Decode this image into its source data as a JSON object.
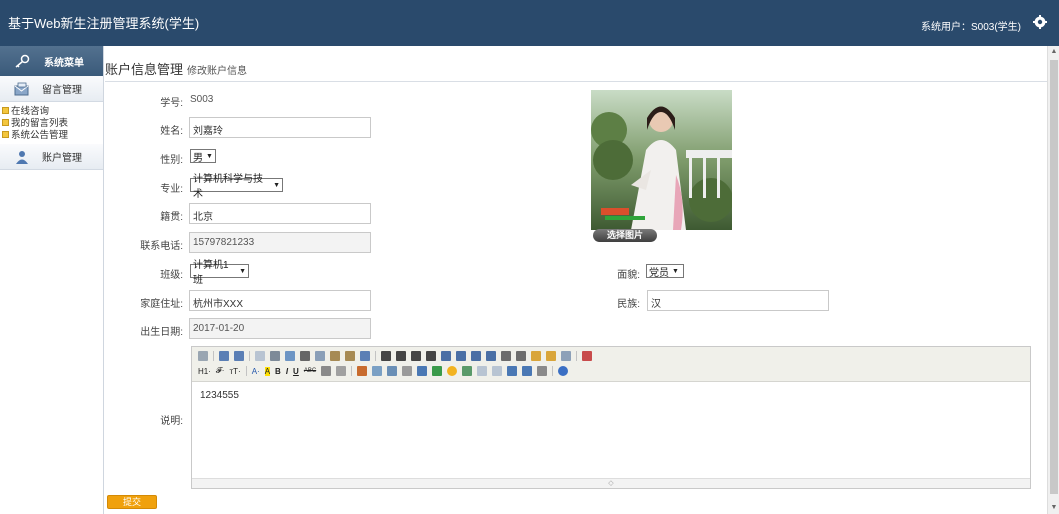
{
  "header": {
    "app_title": "基于Web新生注册管理系统(学生)",
    "user_label": "系统用户：",
    "user_value": "S003(学生)"
  },
  "sidebar": {
    "menu_title": "系统菜单",
    "sections": [
      {
        "label": "留言管理",
        "items": [
          "在线咨询",
          "我的留言列表",
          "系统公告管理"
        ]
      },
      {
        "label": "账户管理",
        "items": []
      }
    ]
  },
  "main": {
    "title": "账户信息管理",
    "subtitle": "修改账户信息"
  },
  "form": {
    "student_id": {
      "label": "学号:",
      "value": "S003"
    },
    "name": {
      "label": "姓名:",
      "value": "刘嘉玲"
    },
    "gender": {
      "label": "性别:",
      "value": "男"
    },
    "major": {
      "label": "专业:",
      "value": "计算机科学与技术"
    },
    "native_place": {
      "label": "籍贯:",
      "value": "北京"
    },
    "phone": {
      "label": "联系电话:",
      "value": "15797821233"
    },
    "class": {
      "label": "班级:",
      "value": "计算机1班"
    },
    "political": {
      "label": "面貌:",
      "value": "党员"
    },
    "address": {
      "label": "家庭住址:",
      "value": "杭州市XXX"
    },
    "ethnicity": {
      "label": "民族:",
      "value": "汉"
    },
    "birthdate": {
      "label": "出生日期:",
      "value": "2017-01-20"
    },
    "description": {
      "label": "说明:",
      "value": "1234555"
    },
    "photo_button": "选择图片",
    "submit_label": "提交"
  },
  "editor": {
    "toolbar_text": {
      "h1": "H1·",
      "font": "𝓕·",
      "size": "тT·",
      "color": "A·",
      "bg": "A",
      "bold": "B",
      "italic": "I",
      "underline": "U",
      "strike": "ABC"
    }
  },
  "colors": {
    "topbar": "#2a4a6c",
    "accent": "#f0a10d"
  }
}
